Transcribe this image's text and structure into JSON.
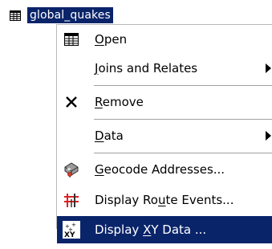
{
  "tree": {
    "layer_name": "global_quakes"
  },
  "menu": {
    "items": [
      {
        "pre": "",
        "key": "O",
        "post": "pen",
        "icon": "table-icon",
        "submenu": false
      },
      {
        "pre": "",
        "key": "J",
        "post": "oins and Relates",
        "icon": "",
        "submenu": true
      },
      {
        "pre": "",
        "key": "R",
        "post": "emove",
        "icon": "remove-x-icon",
        "submenu": false
      },
      {
        "pre": "",
        "key": "D",
        "post": "ata",
        "icon": "",
        "submenu": true
      },
      {
        "pre": "",
        "key": "G",
        "post": "eocode Addresses...",
        "icon": "geocode-icon",
        "submenu": false
      },
      {
        "pre": "Display Ro",
        "key": "u",
        "post": "te Events...",
        "icon": "route-events-icon",
        "submenu": false
      },
      {
        "pre": "Display ",
        "key": "X",
        "post": "Y Data ...",
        "icon": "xy-data-icon",
        "submenu": false
      }
    ],
    "selected_index": 6
  },
  "colors": {
    "selection": "#0a246a",
    "menu_bg": "#ffffff"
  }
}
